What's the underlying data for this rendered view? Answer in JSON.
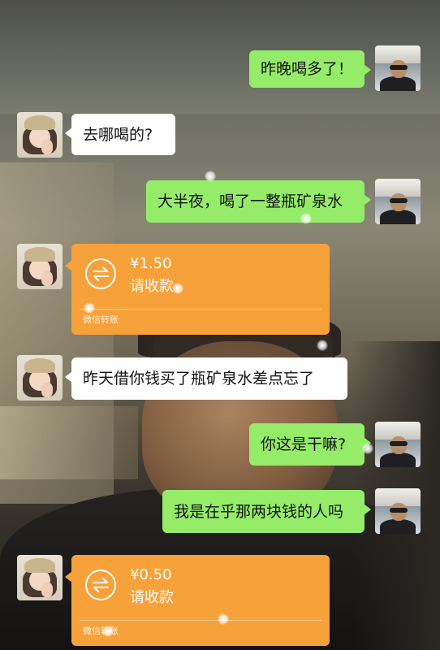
{
  "chat": {
    "messages": [
      {
        "sender": "me",
        "type": "text",
        "text": "昨晚喝多了！"
      },
      {
        "sender": "her",
        "type": "text",
        "text": "去哪喝的?"
      },
      {
        "sender": "me",
        "type": "text",
        "text": "大半夜，喝了一整瓶矿泉水"
      },
      {
        "sender": "her",
        "type": "transfer",
        "amount": "¥1.50",
        "status": "请收款",
        "footer": "微信转账"
      },
      {
        "sender": "her",
        "type": "text",
        "text": "昨天借你钱买了瓶矿泉水差点忘了"
      },
      {
        "sender": "me",
        "type": "text",
        "text": "你这是干嘛?"
      },
      {
        "sender": "me",
        "type": "text",
        "text": "我是在乎那两块钱的人吗"
      },
      {
        "sender": "her",
        "type": "transfer",
        "amount": "¥0.50",
        "status": "请收款",
        "footer": "微信转账"
      }
    ]
  },
  "colors": {
    "my_bubble": "#95ec69",
    "her_bubble": "#ffffff",
    "transfer_card": "#f7a13b"
  },
  "icons": {
    "transfer": "transfer-arrows-icon"
  }
}
